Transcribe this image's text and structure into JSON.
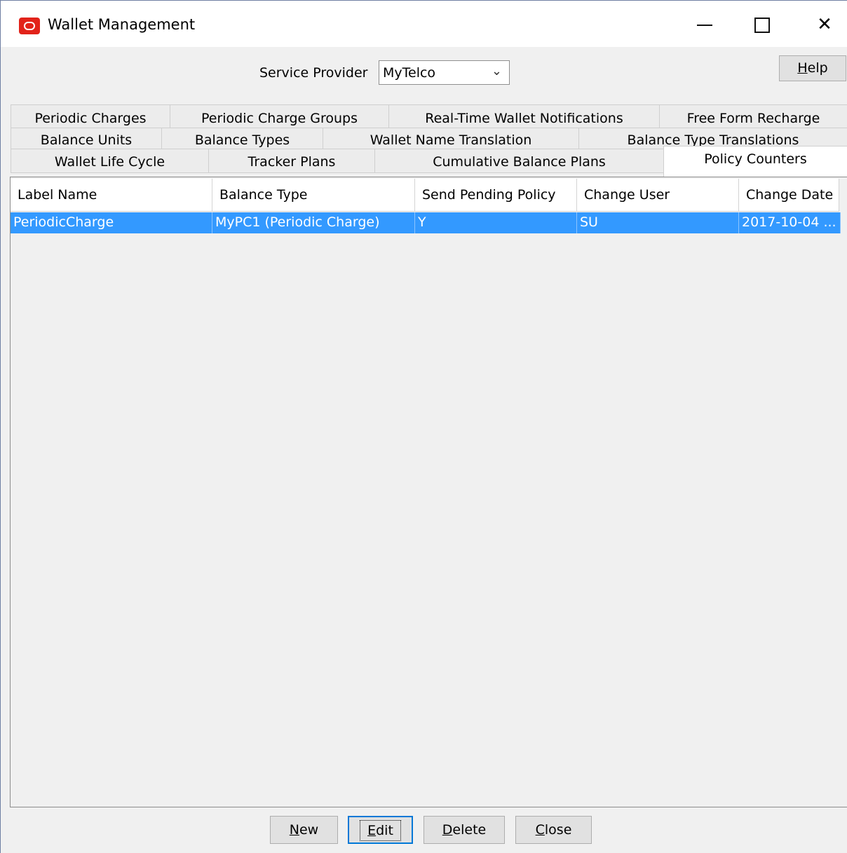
{
  "window": {
    "title": "Wallet Management",
    "minimize": "—",
    "close": "✕"
  },
  "service_provider": {
    "label": "Service Provider",
    "value": "MyTelco"
  },
  "help_button": {
    "mnemonic": "H",
    "rest": "elp"
  },
  "tabs": {
    "row1": [
      "Periodic Charges",
      "Periodic Charge Groups",
      "Real-Time Wallet Notifications",
      "Free Form Recharge"
    ],
    "row2": [
      "Balance Units",
      "Balance Types",
      "Wallet Name Translation",
      "Balance Type Translations"
    ],
    "row3": [
      "Wallet Life Cycle",
      "Tracker Plans",
      "Cumulative Balance Plans",
      "Policy Counters"
    ]
  },
  "table": {
    "columns": [
      "Label Name",
      "Balance Type",
      "Send Pending Policy",
      "Change User",
      "Change Date"
    ],
    "rows": [
      [
        "PeriodicCharge",
        "MyPC1 (Periodic Charge)",
        "Y",
        "SU",
        "2017-10-04 ..."
      ]
    ]
  },
  "buttons": {
    "new": {
      "mnemonic": "N",
      "rest": "ew"
    },
    "edit": {
      "mnemonic": "E",
      "rest": "dit"
    },
    "delete": {
      "mnemonic": "D",
      "rest": "elete"
    },
    "close": {
      "mnemonic": "C",
      "rest": "lose"
    }
  },
  "colors": {
    "selection": "#3399ff",
    "brand": "#e2231a"
  }
}
